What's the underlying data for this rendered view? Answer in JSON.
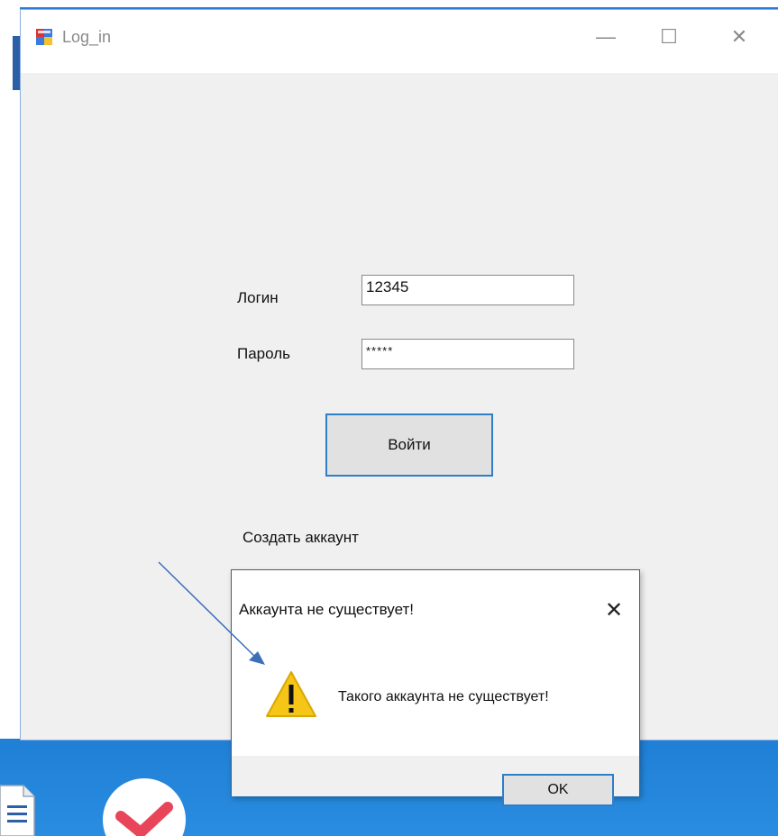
{
  "window": {
    "title": "Log_in",
    "controls": {
      "minimize": "—",
      "maximize": "☐",
      "close": "✕"
    }
  },
  "form": {
    "login_label": "Логин",
    "login_value": "12345",
    "password_label": "Пароль",
    "password_value": "*****",
    "login_button": "Войти",
    "create_account_link": "Создать аккаунт"
  },
  "dialog": {
    "title": "Аккаунта не существует!",
    "close": "✕",
    "message": "Такого аккаунта не существует!",
    "ok_button": "OK",
    "icon": "warning-icon"
  },
  "colors": {
    "accent": "#2f7ec8",
    "window_bg": "#f0f0f0",
    "taskbar": "#2a8de0",
    "warning": "#f5c518"
  }
}
